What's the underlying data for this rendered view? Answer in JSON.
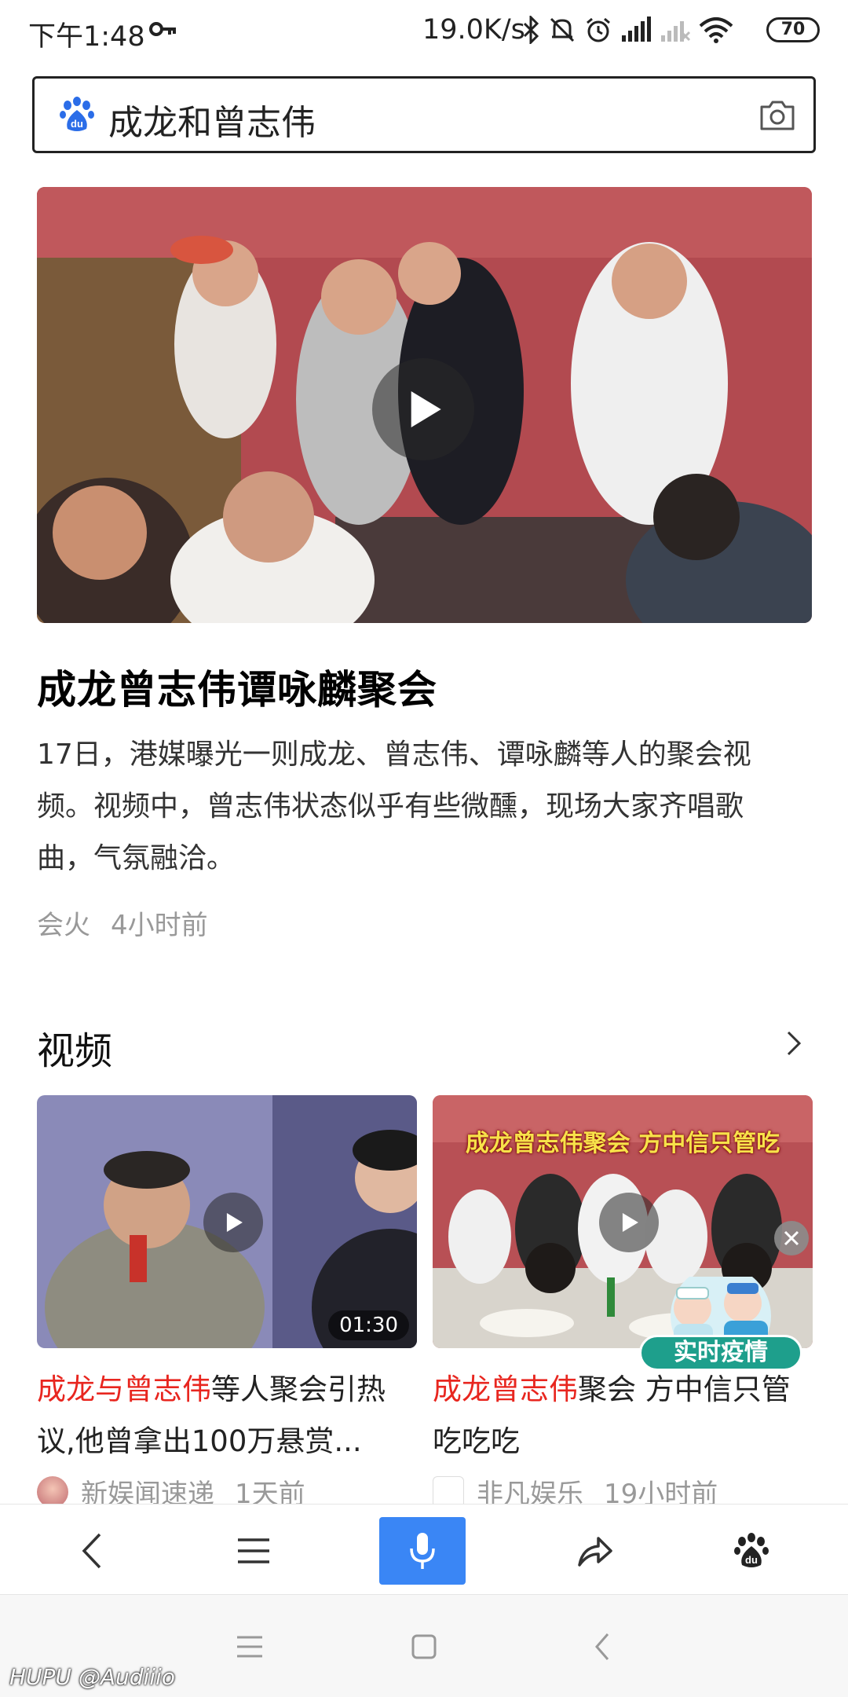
{
  "status_bar": {
    "time": "下午1:48",
    "speed": "19.0K/s",
    "battery": "70",
    "icons": [
      "key-icon",
      "bluetooth-icon",
      "mute-icon",
      "alarm-icon",
      "signal-icon",
      "signal-off-icon",
      "wifi-icon",
      "battery-icon"
    ]
  },
  "search": {
    "query": "成龙和曾志伟",
    "icons": [
      "baidu-paw-icon",
      "camera-icon"
    ]
  },
  "top_story": {
    "headline": "成龙曾志伟谭咏麟聚会",
    "summary": "17日，港媒曝光一则成龙、曾志伟、谭咏麟等人的聚会视频。视频中，曾志伟状态似乎有些微醺，现场大家齐唱歌曲，气氛融洽。",
    "source": "会火",
    "time": "4小时前"
  },
  "video_section": {
    "title": "视频",
    "cards": [
      {
        "title_highlight": "成龙与曾志伟",
        "title_rest": "等人聚会引热议,他曾拿出100万悬赏...",
        "duration": "01:30",
        "source": "新娱闻速递",
        "time": "1天前"
      },
      {
        "title_highlight": "成龙曾志伟",
        "title_rest": "聚会 方中信只管吃吃吃",
        "thumb_caption": "成龙曾志伟聚会 方中信只管吃",
        "source": "非凡娱乐",
        "time": "19小时前"
      }
    ]
  },
  "badge": {
    "label": "实时疫情"
  },
  "toolbar": {
    "icons": [
      "back-icon",
      "menu-icon",
      "microphone-icon",
      "share-icon",
      "baidu-home-icon"
    ]
  },
  "nav": {
    "icons": [
      "recent-apps-icon",
      "home-icon",
      "back-icon"
    ]
  },
  "watermark": "HUPU @Audiiio",
  "colors": {
    "accent": "#3a86f5",
    "highlight": "#e8261f",
    "muted": "#999999"
  }
}
